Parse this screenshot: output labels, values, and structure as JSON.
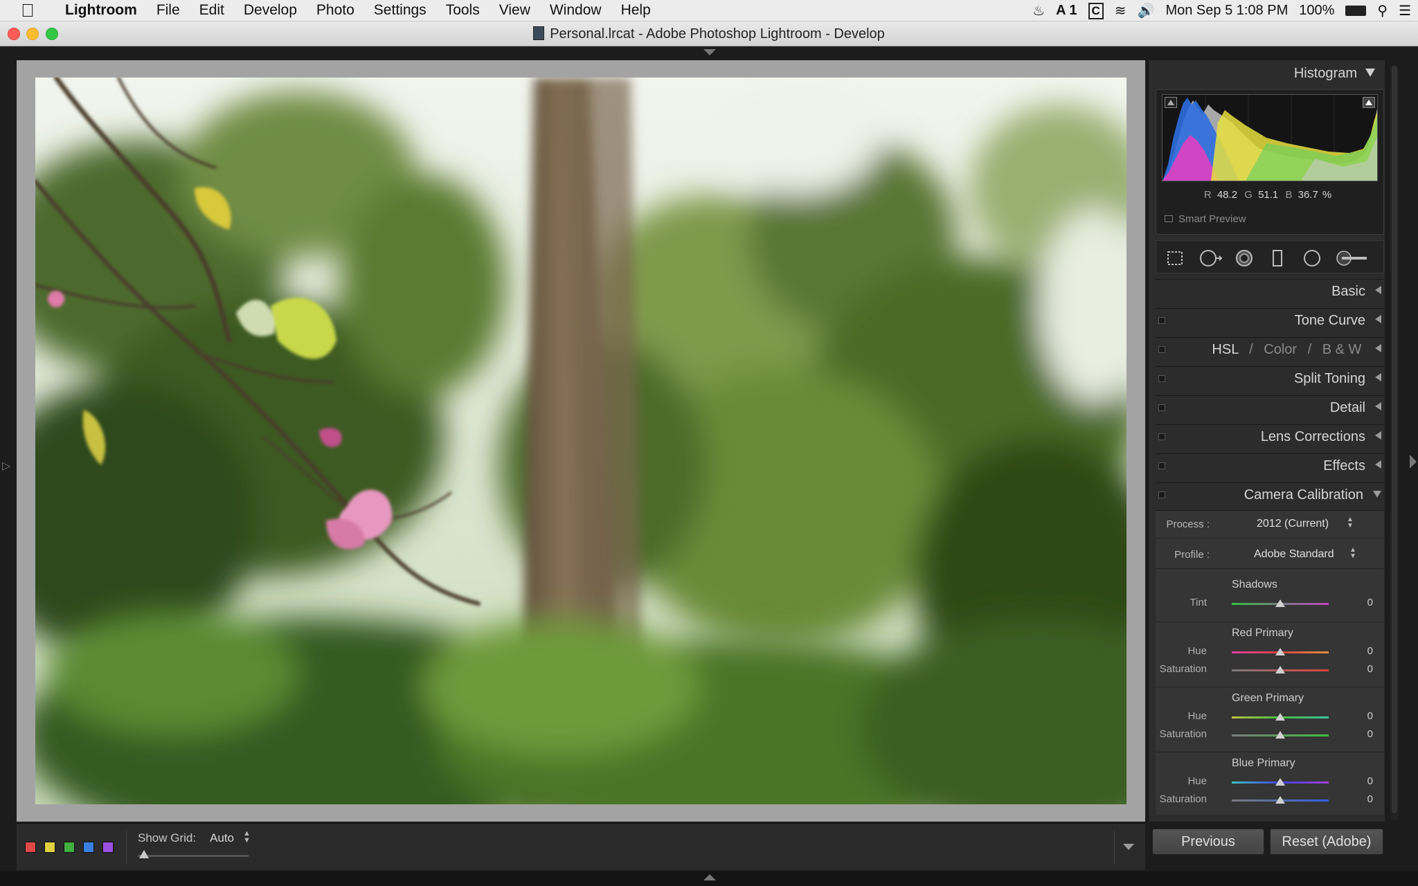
{
  "menubar": {
    "app_name": "Lightroom",
    "items": [
      "File",
      "Edit",
      "Develop",
      "Photo",
      "Settings",
      "Tools",
      "View",
      "Window",
      "Help"
    ],
    "status": {
      "adobe_badge": "1",
      "clock": "Mon Sep 5  1:08 PM",
      "battery": "100%"
    }
  },
  "window": {
    "title": "Personal.lrcat - Adobe Photoshop Lightroom - Develop"
  },
  "toolbar": {
    "show_grid_label": "Show Grid:",
    "show_grid_value": "Auto",
    "color_labels": [
      "#e04848",
      "#e0d040",
      "#40b040",
      "#3a80e0",
      "#9a50e0"
    ]
  },
  "histogram": {
    "title": "Histogram",
    "r_label": "R",
    "r_value": "48.2",
    "g_label": "G",
    "g_value": "51.1",
    "b_label": "B",
    "b_value": "36.7",
    "percent": "%",
    "smart_preview": "Smart Preview"
  },
  "panels": {
    "basic": "Basic",
    "tone_curve": "Tone Curve",
    "hsl": "HSL",
    "slash": "/",
    "color": "Color",
    "bw": "B & W",
    "split_toning": "Split Toning",
    "detail": "Detail",
    "lens_corrections": "Lens Corrections",
    "effects": "Effects",
    "camera_calibration": "Camera Calibration"
  },
  "calibration": {
    "process_label": "Process :",
    "process_value": "2012 (Current)",
    "profile_label": "Profile :",
    "profile_value": "Adobe Standard",
    "shadows": "Shadows",
    "tint_label": "Tint",
    "tint_value": "0",
    "red_primary": "Red Primary",
    "green_primary": "Green Primary",
    "blue_primary": "Blue Primary",
    "hue_label": "Hue",
    "saturation_label": "Saturation",
    "red_hue": "0",
    "red_sat": "0",
    "green_hue": "0",
    "green_sat": "0",
    "blue_hue": "0",
    "blue_sat": "0"
  },
  "buttons": {
    "previous": "Previous",
    "reset": "Reset (Adobe)"
  }
}
